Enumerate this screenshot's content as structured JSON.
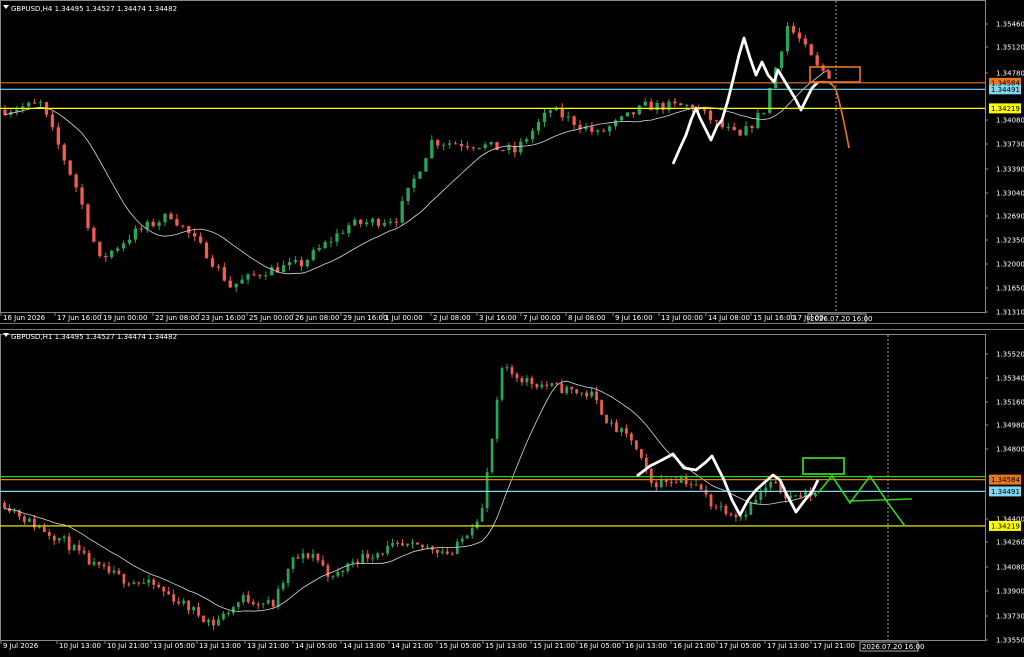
{
  "colors": {
    "bg": "#000000",
    "bull": "#26a65b",
    "bear": "#f25c54",
    "ma": "#d9d9d9",
    "orange": "#e8771e",
    "cyan": "#7fd8ef",
    "yellow": "#ffff00",
    "green": "#2fd41a",
    "axisBg": "#000000",
    "tag": "#ffffff"
  },
  "icons": [
    "triangle-down-icon"
  ],
  "chart_data": [
    {
      "type": "candlestick",
      "title": "GBPUSD,H4 1.34495 1.34527 1.34474 1.34482",
      "ylim": [
        1.3131,
        1.3571
      ],
      "y_ticks": [
        "1.35460",
        "1.35120",
        "1.34780",
        "1.34080",
        "1.33730",
        "1.33390",
        "1.33040",
        "1.32690",
        "1.32350",
        "1.32000",
        "1.31650",
        "1.31310"
      ],
      "x_ticks": [
        "16 Jun 2026",
        "17 Jun 16:00",
        "19 Jun 00:00",
        "22 Jun 08:00",
        "23 Jun 16:00",
        "25 Jun 00:00",
        "26 Jun 08:00",
        "29 Jun 16:00",
        "1 Jul 00:00",
        "2 Jul 08:00",
        "3 Jul 16:00",
        "7 Jul 00:00",
        "8 Jul 08:00",
        "9 Jul 16:00",
        "13 Jul 00:00",
        "14 Jul 08:00",
        "15 Jul 16:00",
        "17 Jul 00:"
      ],
      "cursor_label": "2026.07.20 16:00",
      "levels": [
        {
          "label": "1.34584",
          "value": 1.34584,
          "color": "#e8771e"
        },
        {
          "label": "1.34491",
          "value": 1.34491,
          "color": "#7fd8ef"
        },
        {
          "label": "1.34219",
          "value": 1.34219,
          "color": "#ffff00"
        }
      ],
      "gen": {
        "n": 140,
        "seed": 7,
        "anchors": [
          [
            0,
            1.342
          ],
          [
            6,
            1.3428
          ],
          [
            12,
            1.331
          ],
          [
            16,
            1.3205
          ],
          [
            22,
            1.3245
          ],
          [
            28,
            1.327
          ],
          [
            34,
            1.3215
          ],
          [
            38,
            1.3168
          ],
          [
            44,
            1.319
          ],
          [
            50,
            1.32
          ],
          [
            58,
            1.3255
          ],
          [
            66,
            1.3265
          ],
          [
            72,
            1.3375
          ],
          [
            80,
            1.337
          ],
          [
            86,
            1.336
          ],
          [
            92,
            1.342
          ],
          [
            100,
            1.3385
          ],
          [
            108,
            1.3425
          ],
          [
            116,
            1.3425
          ],
          [
            120,
            1.34
          ],
          [
            124,
            1.338
          ],
          [
            128,
            1.342
          ],
          [
            132,
            1.354
          ],
          [
            134,
            1.352
          ],
          [
            137,
            1.348
          ],
          [
            140,
            1.3465
          ]
        ]
      }
    },
    {
      "type": "candlestick",
      "title": "GBPUSD,H1 1.34495 1.34527 1.34474 1.34482",
      "ylim": [
        1.3332,
        1.357
      ],
      "y_ticks": [
        "1.35520",
        "1.35340",
        "1.35160",
        "1.34980",
        "1.34800",
        "1.34400",
        "1.34260",
        "1.34080",
        "1.33900",
        "1.33730",
        "1.33550"
      ],
      "x_ticks": [
        "9 Jul 2026",
        "10 Jul 13:00",
        "10 Jul 21:00",
        "13 Jul 05:00",
        "13 Jul 13:00",
        "13 Jul 21:00",
        "14 Jul 05:00",
        "14 Jul 13:00",
        "14 Jul 21:00",
        "15 Jul 05:00",
        "15 Jul 13:00",
        "15 Jul 21:00",
        "16 Jul 05:00",
        "16 Jul 13:00",
        "16 Jul 21:00",
        "17 Jul 05:00",
        "17 Jul 13:00",
        "17 Jul 21:00"
      ],
      "cursor_label": "2026.07.20 16:00",
      "levels": [
        {
          "label": "1.34584",
          "value": 1.34584,
          "color": "#e8771e"
        },
        {
          "label": "1.34491",
          "value": 1.34491,
          "color": "#7fd8ef"
        },
        {
          "label": "1.34219",
          "value": 1.34219,
          "color": "#ffff00"
        }
      ],
      "gen": {
        "n": 140,
        "seed": 11,
        "anchors": [
          [
            0,
            1.344
          ],
          [
            5,
            1.3425
          ],
          [
            12,
            1.341
          ],
          [
            18,
            1.339
          ],
          [
            24,
            1.338
          ],
          [
            30,
            1.3375
          ],
          [
            36,
            1.336
          ],
          [
            42,
            1.3345
          ],
          [
            48,
            1.3365
          ],
          [
            54,
            1.336
          ],
          [
            58,
            1.3395
          ],
          [
            62,
            1.34
          ],
          [
            66,
            1.338
          ],
          [
            70,
            1.3395
          ],
          [
            78,
            1.3405
          ],
          [
            86,
            1.3405
          ],
          [
            90,
            1.34
          ],
          [
            96,
            1.3435
          ],
          [
            100,
            1.3545
          ],
          [
            106,
            1.3535
          ],
          [
            112,
            1.353
          ],
          [
            118,
            1.3525
          ],
          [
            122,
            1.35
          ],
          [
            126,
            1.349
          ],
          [
            130,
            1.3455
          ],
          [
            136,
            1.346
          ],
          [
            140,
            1.345
          ],
          [
            142,
            1.344
          ],
          [
            148,
            1.343
          ],
          [
            154,
            1.3455
          ],
          [
            158,
            1.3445
          ],
          [
            164,
            1.3448
          ]
        ]
      }
    }
  ]
}
